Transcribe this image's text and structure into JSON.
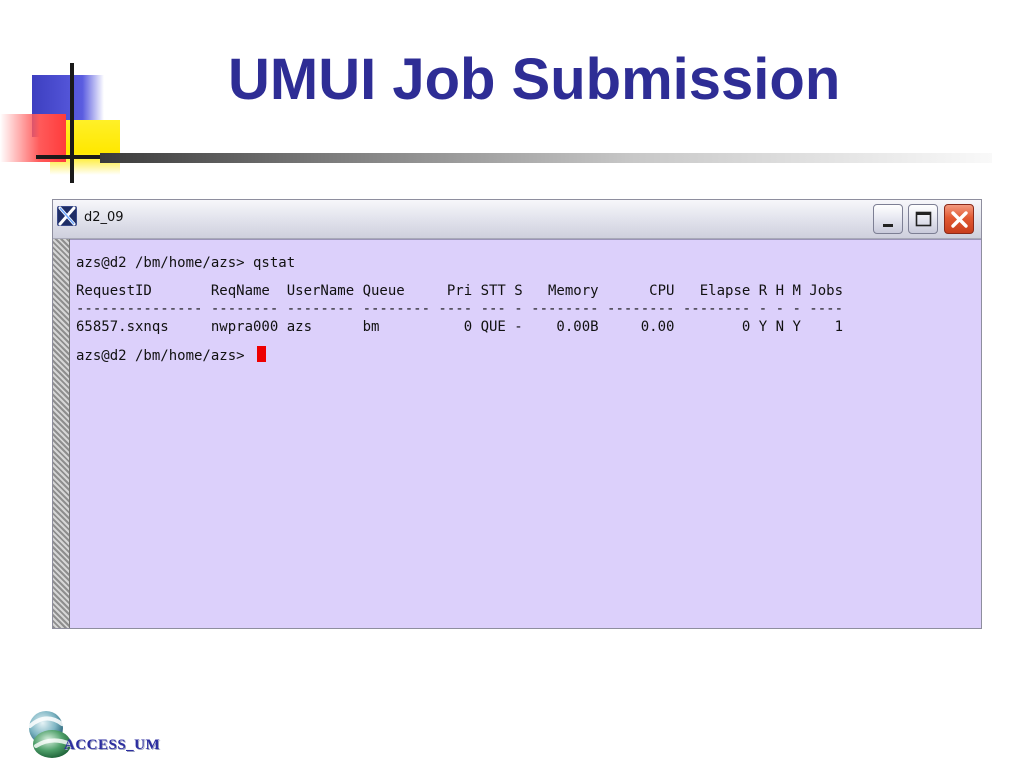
{
  "slide": {
    "title": "UMUI Job Submission"
  },
  "window": {
    "title": "d2_09",
    "icon": "x-terminal-icon",
    "buttons": {
      "minimize": "minimize-icon",
      "maximize": "maximize-icon",
      "close": "close-icon"
    }
  },
  "terminal": {
    "prompt_command": "azs@d2 /bm/home/azs> qstat",
    "header": "RequestID       ReqName  UserName Queue     Pri STT S   Memory      CPU   Elapse R H M Jobs",
    "separator": "--------------- -------- -------- -------- ---- --- - -------- -------- -------- - - - ----",
    "row": "65857.sxnqs     nwpra000 azs      bm          0 QUE -    0.00B     0.00        0 Y N Y    1",
    "prompt_current": "azs@d2 /bm/home/azs> ",
    "cursor_color": "#ee0000",
    "background_color": "#dcd0fb"
  },
  "colors": {
    "title": "#2e2d95",
    "logo_text": "#2c2ea0"
  },
  "logo": {
    "text": "ACCESS_UM"
  }
}
